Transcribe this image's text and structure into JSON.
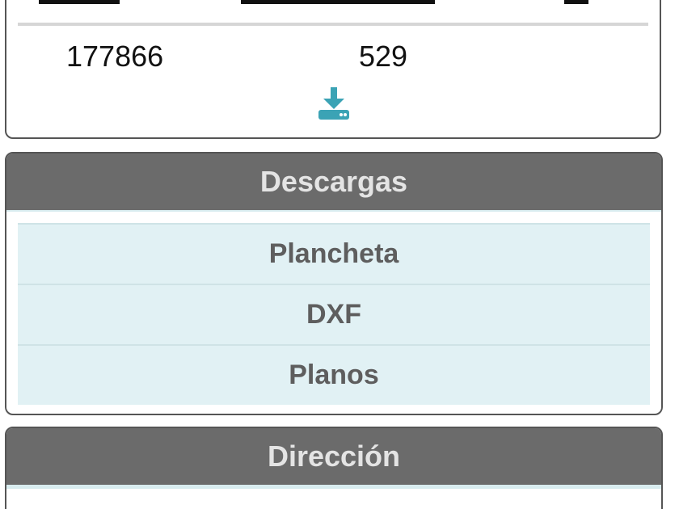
{
  "top_card": {
    "values": [
      "177866",
      "529"
    ],
    "download_icon": "download-icon",
    "accent_color": "#3ba3b5"
  },
  "downloads_panel": {
    "title": "Descargas",
    "items": [
      {
        "label": "Plancheta"
      },
      {
        "label": "DXF"
      },
      {
        "label": "Planos"
      }
    ]
  },
  "address_panel": {
    "title": "Dirección",
    "icon": "leaf-icon"
  },
  "colors": {
    "panel_header_bg": "#6b6b6b",
    "list_bg": "#e1f1f4",
    "accent": "#3ba3b5"
  }
}
